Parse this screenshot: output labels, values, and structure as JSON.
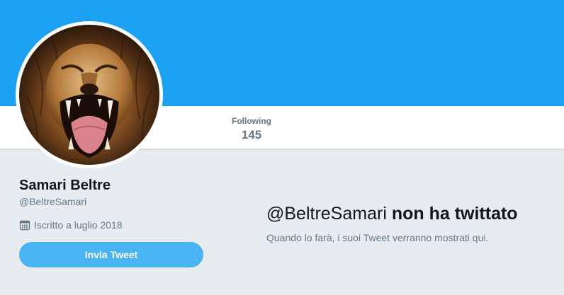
{
  "profile": {
    "name": "Samari Beltre",
    "handle": "@BeltreSamari",
    "joined": "Iscritto a luglio 2018",
    "calendar_icon": "calendar-icon",
    "avatar": "lion-roaring"
  },
  "stats": {
    "following_label": "Following",
    "following_value": "145"
  },
  "actions": {
    "tweet_button_label": "Invia Tweet"
  },
  "empty_state": {
    "handle": "@BeltreSamari",
    "title_rest": "non ha twittato",
    "subtitle": "Quando lo farà, i suoi Tweet verranno mostrati qui."
  },
  "colors": {
    "banner": "#1da1f2",
    "page_background": "#e6ecf0",
    "button": "#4ab3f4",
    "secondary_text": "#657786",
    "primary_text": "#14171a"
  }
}
